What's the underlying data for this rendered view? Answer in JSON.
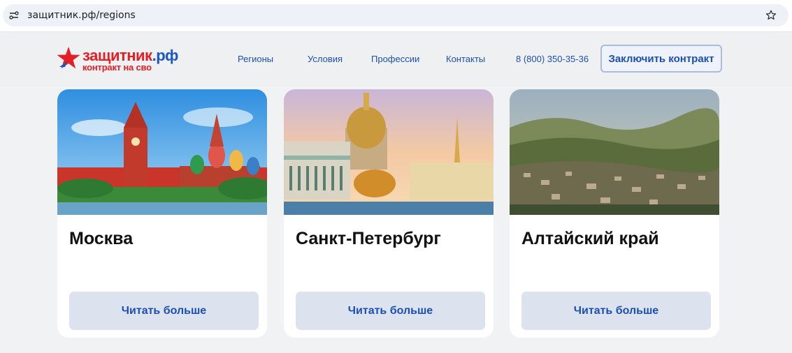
{
  "browser": {
    "url": "защитник.рф/regions"
  },
  "header": {
    "logo": {
      "name": "защитник",
      "tld": ".рф",
      "subtitle": "контракт на сво"
    },
    "nav": [
      "Регионы",
      "Условия",
      "Профессии",
      "Контакты"
    ],
    "phone": "8 (800) 350-35-36",
    "cta_label": "Заключить контракт"
  },
  "cards": [
    {
      "title": "Москва",
      "button": "Читать больше"
    },
    {
      "title": "Санкт-Петербург",
      "button": "Читать больше"
    },
    {
      "title": "Алтайский край",
      "button": "Читать больше"
    }
  ],
  "colors": {
    "accent": "#1c4fb3",
    "brand_red": "#e31e24",
    "button_bg": "#dde3ee"
  }
}
